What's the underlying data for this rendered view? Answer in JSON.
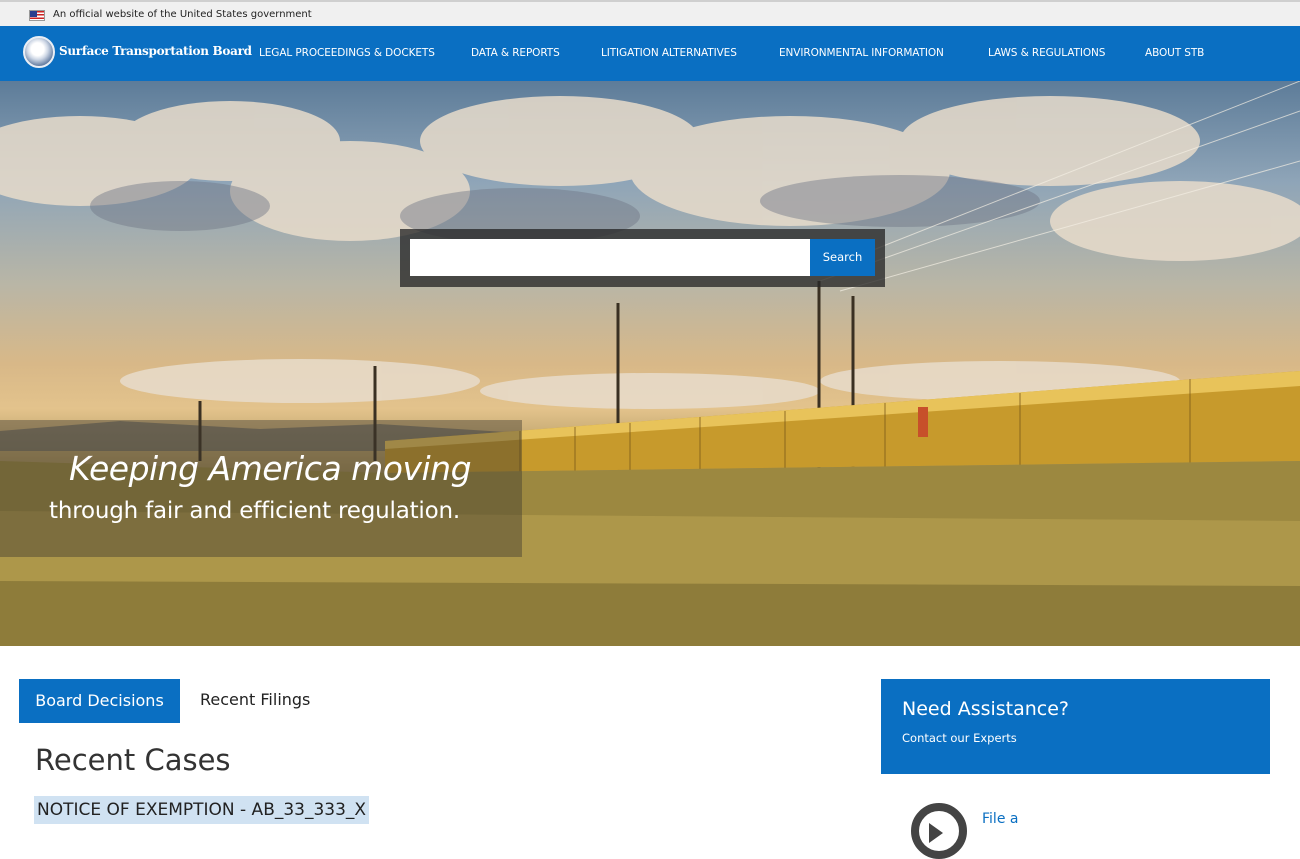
{
  "gov_banner": {
    "text": "An official website of the United States government",
    "flag_icon": "us-flag-icon"
  },
  "header": {
    "site_name": "Surface Transportation Board",
    "logo_icon": "stb-seal-icon",
    "nav": [
      "LEGAL PROCEEDINGS & DOCKETS",
      "DATA & REPORTS",
      "LITIGATION ALTERNATIVES",
      "ENVIRONMENTAL INFORMATION",
      "LAWS & REGULATIONS",
      "ABOUT STB"
    ]
  },
  "hero": {
    "search_value": "",
    "search_button": "Search",
    "tagline_line1": "Keeping America moving",
    "tagline_line2": "through fair and efficient regulation."
  },
  "tabs": {
    "active": "Board Decisions",
    "inactive": "Recent Filings"
  },
  "main": {
    "heading": "Recent Cases",
    "cases": [
      "NOTICE OF EXEMPTION - AB_33_333_X"
    ]
  },
  "assist": {
    "title": "Need Assistance?",
    "subtitle": "Contact our Experts"
  },
  "file": {
    "label": "File a",
    "icon": "arrow-circle-right-icon"
  },
  "colors": {
    "brand_blue": "#0a6fc2",
    "banner_gray": "#f0f0f0",
    "case_highlight": "#d0e2f2"
  }
}
